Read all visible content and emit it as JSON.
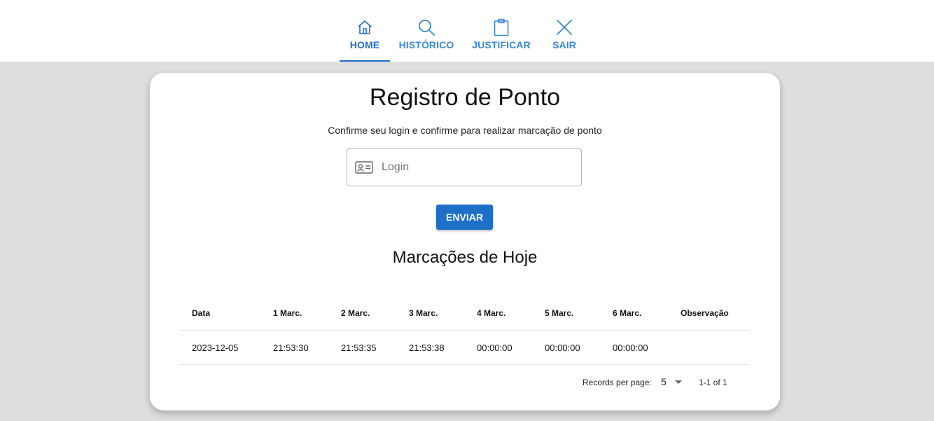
{
  "nav": {
    "items": [
      {
        "label": "HOME",
        "icon": "home-icon",
        "active": true
      },
      {
        "label": "HISTÓRICO",
        "icon": "search-icon",
        "active": false
      },
      {
        "label": "JUSTIFICAR",
        "icon": "clipboard-icon",
        "active": false
      },
      {
        "label": "SAIR",
        "icon": "close-icon",
        "active": false
      }
    ]
  },
  "colors": {
    "primary": "#1e6fc8",
    "nav_text": "#3b87d4",
    "background": "#dedede",
    "card": "#ffffff"
  },
  "main": {
    "title": "Registro de Ponto",
    "subtitle": "Confirme seu login e confirme para realizar marcação de ponto",
    "login": {
      "placeholder": "Login",
      "value": "",
      "icon": "id-card-icon"
    },
    "submit_label": "ENVIAR",
    "section_title": "Marcações de Hoje"
  },
  "table": {
    "headers": [
      "Data",
      "1 Marc.",
      "2 Marc.",
      "3 Marc.",
      "4 Marc.",
      "5 Marc.",
      "6 Marc.",
      "Observação"
    ],
    "rows": [
      [
        "2023-12-05",
        "21:53:30",
        "21:53:35",
        "21:53:38",
        "00:00:00",
        "00:00:00",
        "00:00:00",
        ""
      ]
    ]
  },
  "pagination": {
    "records_label": "Records per page:",
    "per_page": "5",
    "range": "1-1 of 1"
  }
}
